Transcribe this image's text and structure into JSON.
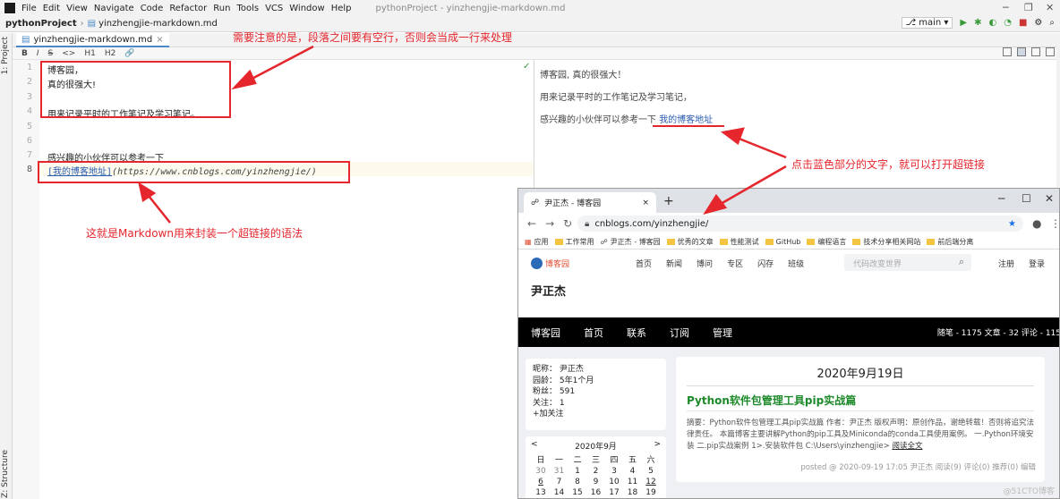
{
  "ide": {
    "menu": [
      "File",
      "Edit",
      "View",
      "Navigate",
      "Code",
      "Refactor",
      "Run",
      "Tools",
      "VCS",
      "Window",
      "Help"
    ],
    "window_title": "pythonProject - yinzhengjie-markdown.md",
    "breadcrumb": [
      "pythonProject",
      "yinzhengjie-markdown.md"
    ],
    "branch": "main",
    "tab_label": "yinzhengjie-markdown.md",
    "toolbar": [
      "B",
      "I",
      "S",
      "<>",
      "H1",
      "H2",
      "🔗"
    ],
    "left_strip": {
      "project": "1: Project",
      "structure": "Z: Structure"
    },
    "line_numbers": [
      "1",
      "2",
      "3",
      "4",
      "5",
      "6",
      "7",
      "8"
    ],
    "lines": {
      "l1": "博客园，",
      "l2": "真的很强大!",
      "l4": "用来记录平时的工作笔记及学习笔记。",
      "l7": "感兴趣的小伙伴可以参考一下",
      "l8_text": "[我的博客地址]",
      "l8_url": "(https://www.cnblogs.com/yinzhengjie/)"
    },
    "preview": {
      "p1": "博客园, 真的很强大！",
      "p2": "用来记录平时的工作笔记及学习笔记，",
      "p3_text": "感兴趣的小伙伴可以参考一下",
      "p3_link": "我的博客地址"
    }
  },
  "annotations": {
    "top": "需要注意的是，段落之间要有空行，否则会当成一行来处理",
    "right": "点击蓝色部分的文字，就可以打开超链接",
    "bottom": "这就是Markdown用来封装一个超链接的语法"
  },
  "browser": {
    "tab_title": "尹正杰 - 博客园",
    "url": "cnblogs.com/yinzhengjie/",
    "bookmarks": [
      "应用",
      "工作常用",
      "尹正杰 - 博客园",
      "优秀的文章",
      "性能测试",
      "GitHub",
      "编程语言",
      "技术分享相关网站",
      "前后端分离"
    ],
    "site": {
      "logo": "博客园",
      "nav": [
        "首页",
        "新闻",
        "博问",
        "专区",
        "闪存",
        "班级"
      ],
      "search_placeholder": "代码改变世界",
      "register": "注册",
      "login": "登录",
      "blog_title": "尹正杰",
      "dark_nav": [
        "博客园",
        "首页",
        "联系",
        "订阅",
        "管理"
      ],
      "stats": "随笔 - 1175  文章 - 32  评论 - 115",
      "profile": [
        "昵称：  尹正杰",
        "园龄：  5年1个月",
        "粉丝：  591",
        "关注：  1",
        "+加关注"
      ],
      "calendar": {
        "prev": "<",
        "month": "2020年9月",
        "next": ">",
        "weekdays": [
          "日",
          "一",
          "二",
          "三",
          "四",
          "五",
          "六"
        ],
        "row1": [
          "30",
          "31",
          "1",
          "2",
          "3",
          "4",
          "5"
        ],
        "row2": [
          "6",
          "7",
          "8",
          "9",
          "10",
          "11",
          "12"
        ],
        "row3": [
          "13",
          "14",
          "15",
          "16",
          "17",
          "18",
          "19"
        ]
      },
      "post_date": "2020年9月19日",
      "post_title": "Python软件包管理工具pip实战篇",
      "summary": "摘要：Python软件包管理工具pip实战篇 作者：尹正杰 版权声明：原创作品，谢绝转载！否则将追究法律责任。 本篇博客主要讲解Python的pip工具及Miniconda的conda工具使用案例。 一.Python环境安装 二.pip实战案例 1>.安装软件包 C:\\Users\\yinzhengjie>",
      "read_more": "阅读全文",
      "post_meta": "posted @ 2020-09-19 17:05 尹正杰 阅读(9) 评论(0) 推荐(0) 编辑"
    }
  },
  "watermark": "@51CTO博客",
  "colors": {
    "annotation_red": "#e5262d",
    "link_blue": "#2a5cb0",
    "post_green": "#1d8a2a"
  }
}
